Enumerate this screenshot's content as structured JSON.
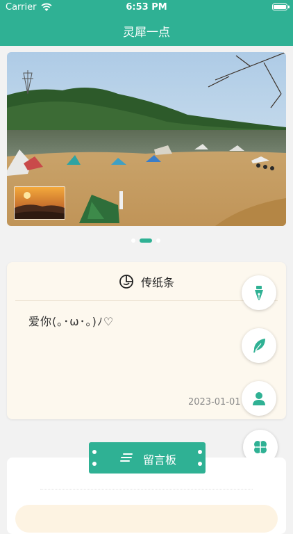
{
  "status_bar": {
    "carrier": "Carrier",
    "time": "6:53 PM"
  },
  "header": {
    "title": "灵犀一点"
  },
  "banner": {
    "image_name": "lake-camping-photo",
    "thumbnail_name": "sunset-thumbnail",
    "page_count": 3,
    "active_page": 1
  },
  "note_card": {
    "title": "传纸条",
    "icon": "moon-clock-icon",
    "message": "爱你(｡･ω･｡)ﾉ♡",
    "date": "2023-01-01"
  },
  "fab_buttons": [
    {
      "name": "pen-nib-icon"
    },
    {
      "name": "feather-icon"
    },
    {
      "name": "person-icon"
    },
    {
      "name": "clover-icon"
    }
  ],
  "message_board": {
    "label": "留言板",
    "icon": "lines-icon"
  },
  "colors": {
    "accent": "#2fb194",
    "card_bg": "#fdf8ee",
    "page_bg": "#f2f2f2"
  }
}
